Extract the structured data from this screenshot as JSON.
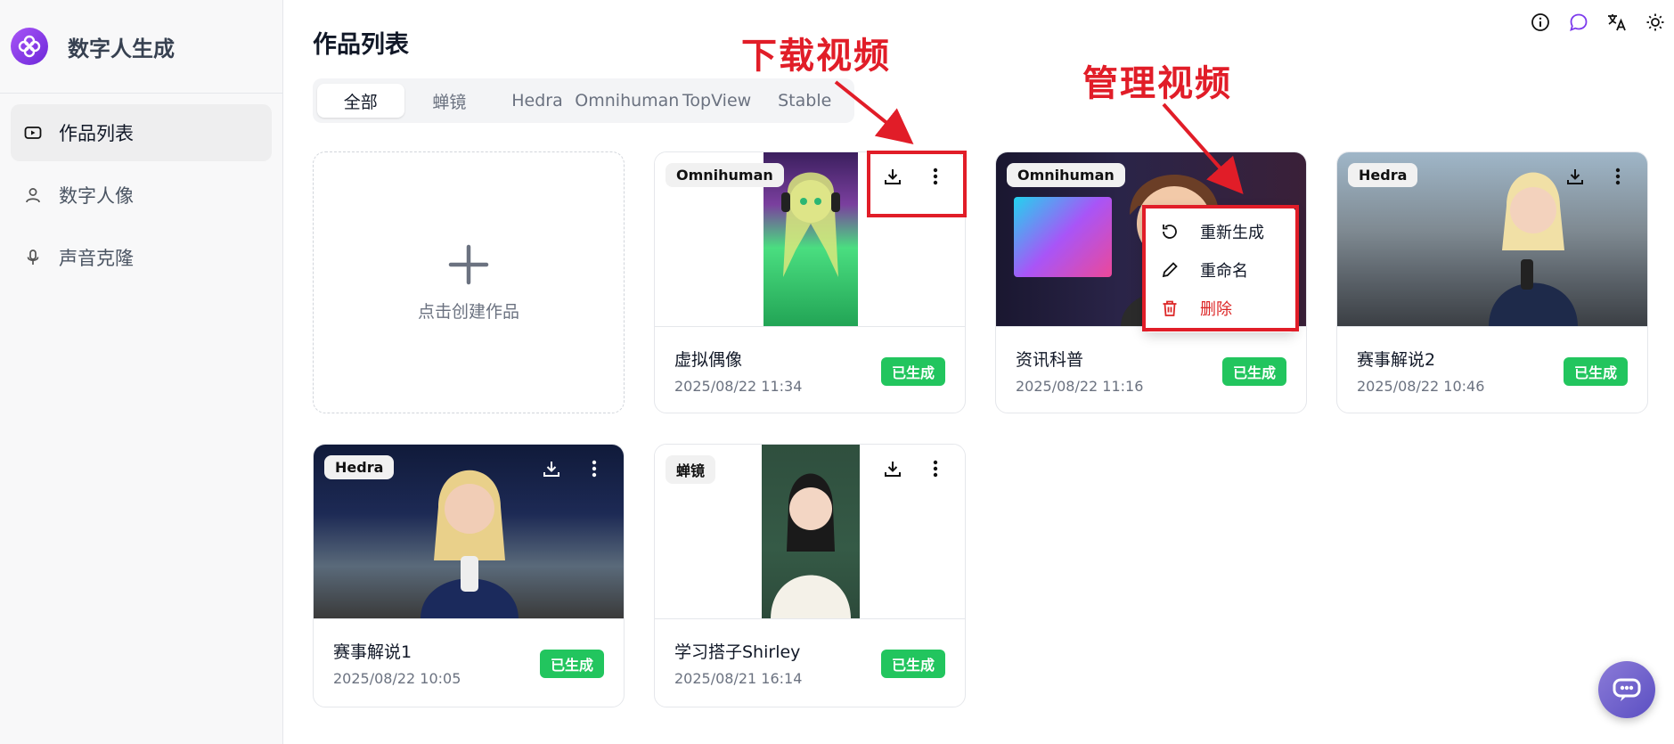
{
  "app": {
    "title": "数字人生成"
  },
  "sidebar": {
    "items": [
      {
        "label": "作品列表",
        "icon": "video-icon",
        "active": true
      },
      {
        "label": "数字人像",
        "icon": "user-icon",
        "active": false
      },
      {
        "label": "声音克隆",
        "icon": "microphone-icon",
        "active": false
      }
    ]
  },
  "main": {
    "title": "作品列表",
    "tabs": [
      "全部",
      "蝉镜",
      "Hedra",
      "Omnihuman",
      "TopView",
      "Stable"
    ],
    "active_tab": "全部",
    "create_label": "点击创建作品"
  },
  "cards": [
    {
      "tag": "Omnihuman",
      "title": "虚拟偶像",
      "date": "2025/08/22 11:34",
      "status": "已生成"
    },
    {
      "tag": "Omnihuman",
      "title": "资讯科普",
      "date": "2025/08/22 11:16",
      "status": "已生成"
    },
    {
      "tag": "Hedra",
      "title": "赛事解说2",
      "date": "2025/08/22 10:46",
      "status": "已生成"
    },
    {
      "tag": "Hedra",
      "title": "赛事解说1",
      "date": "2025/08/22 10:05",
      "status": "已生成"
    },
    {
      "tag": "蝉镜",
      "title": "学习搭子Shirley",
      "date": "2025/08/21 16:14",
      "status": "已生成"
    }
  ],
  "menu": {
    "items": [
      {
        "label": "重新生成",
        "icon": "refresh-icon"
      },
      {
        "label": "重命名",
        "icon": "pencil-icon"
      },
      {
        "label": "删除",
        "icon": "trash-icon"
      }
    ]
  },
  "annotations": {
    "download": "下载视频",
    "manage": "管理视频"
  },
  "colors": {
    "accent": "#7c3aed",
    "success": "#22c55e",
    "annotation": "#e11d28",
    "danger": "#dc2626"
  }
}
